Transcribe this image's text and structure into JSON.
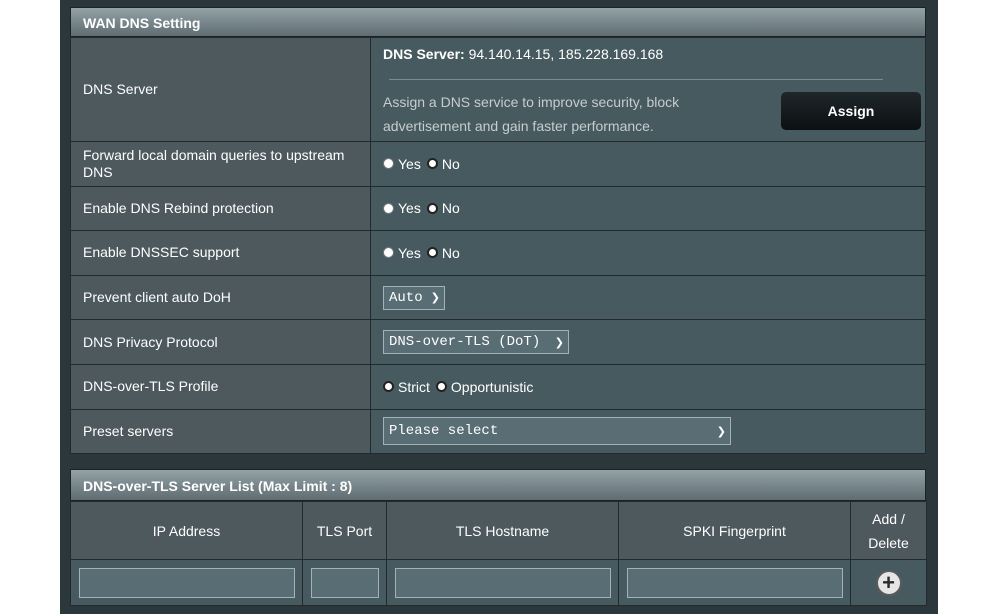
{
  "wan_dns": {
    "header": "WAN DNS Setting",
    "dns_server": {
      "label": "DNS Server",
      "prefix": "DNS Server:",
      "value": "94.140.14.15, 185.228.169.168",
      "description": "Assign a DNS service to improve security, block advertisement and gain faster performance.",
      "assign_label": "Assign"
    },
    "forward_local": {
      "label": "Forward local domain queries to upstream DNS",
      "yes": "Yes",
      "no": "No",
      "selected": "No"
    },
    "rebind": {
      "label": "Enable DNS Rebind protection",
      "yes": "Yes",
      "no": "No",
      "selected": "No"
    },
    "dnssec": {
      "label": "Enable DNSSEC support",
      "yes": "Yes",
      "no": "No",
      "selected": "No"
    },
    "auto_doh": {
      "label": "Prevent client auto DoH",
      "value": "Auto"
    },
    "privacy": {
      "label": "DNS Privacy Protocol",
      "value": "DNS-over-TLS (DoT)"
    },
    "tls_profile": {
      "label": "DNS-over-TLS Profile",
      "strict": "Strict",
      "opportunistic": "Opportunistic",
      "selected": "Strict"
    },
    "preset": {
      "label": "Preset servers",
      "value": "Please select"
    }
  },
  "server_list": {
    "header": "DNS-over-TLS Server List (Max Limit : 8)",
    "columns": [
      "IP Address",
      "TLS Port",
      "TLS Hostname",
      "SPKI Fingerprint"
    ],
    "add_delete_line1": "Add /",
    "add_delete_line2": "Delete",
    "add_icon": "plus-circle-icon",
    "inputs": {
      "ip": "",
      "port": "",
      "hostname": "",
      "fingerprint": ""
    }
  }
}
